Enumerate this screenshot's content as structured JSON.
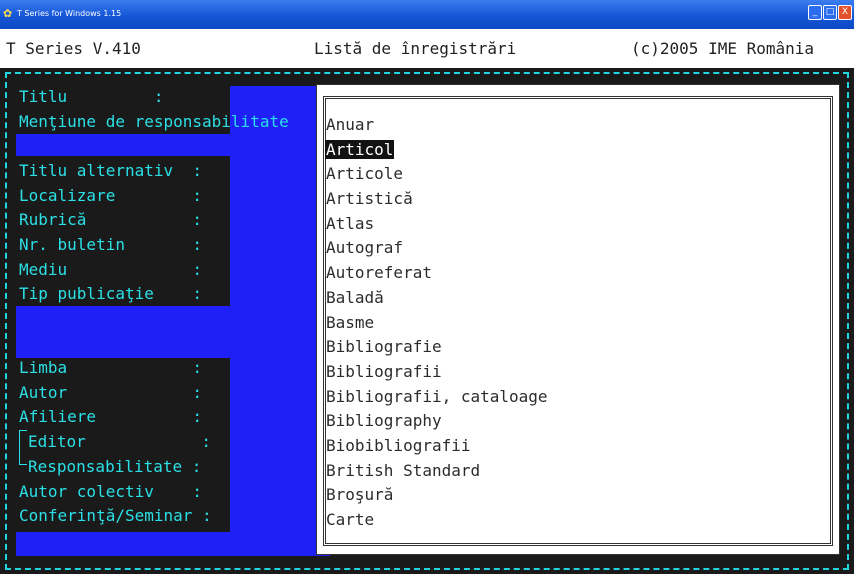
{
  "window": {
    "title": "T Series for Windows 1.15",
    "buttons": {
      "minimize": "_",
      "maximize": "□",
      "close": "X"
    }
  },
  "header": {
    "version": "T Series V.410",
    "screen_title": "Listă de înregistrări",
    "copyright": "(c)2005 IME România"
  },
  "form": {
    "fields": [
      "Titlu         :",
      "Menţiune de responsabilitate",
      "Titlu alternativ  :",
      "Localizare        :",
      "Rubrică           :",
      "Nr. buletin       :",
      "Mediu             :",
      "Tip publicaţie    :",
      "Limba             :",
      "Autor             :",
      "Afiliere          :",
      "Editor            :",
      "Responsabilitate :",
      "Autor colectiv    :",
      "Conferinţă/Seminar :"
    ]
  },
  "popup": {
    "selected": "Articol",
    "items": [
      "Anuar",
      "Articol",
      "Articole",
      "Artistică",
      "Atlas",
      "Autograf",
      "Autoreferat",
      "Baladă",
      "Basme",
      "Bibliografie",
      "Bibliografii",
      "Bibliografii, cataloage",
      "Bibliography",
      "Biobibliografii",
      "British Standard",
      "Broşură",
      "Carte"
    ]
  },
  "colors": {
    "titlebar": "#1556d6",
    "console_bg": "#1a1a1a",
    "field_text": "#2ae0e6",
    "blue": "#1f1ff7",
    "popup_bg": "#ffffff",
    "selection_bg": "#121212"
  }
}
